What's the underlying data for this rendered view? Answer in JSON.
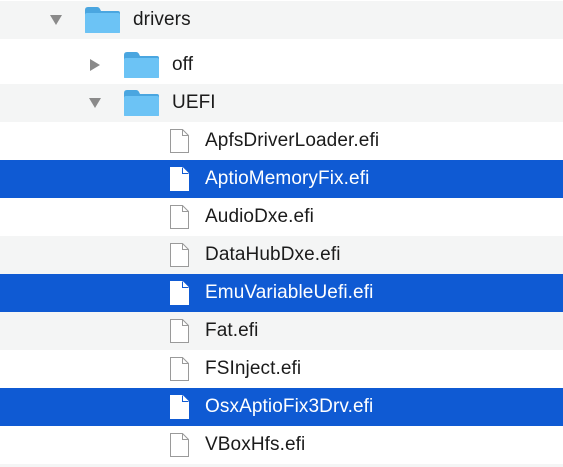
{
  "tree": {
    "folders": {
      "drivers": {
        "label": "drivers",
        "expanded": true
      },
      "off": {
        "label": "off",
        "expanded": false
      },
      "uefi": {
        "label": "UEFI",
        "expanded": true
      }
    },
    "files": [
      {
        "label": "ApfsDriverLoader.efi",
        "selected": false
      },
      {
        "label": "AptioMemoryFix.efi",
        "selected": true
      },
      {
        "label": "AudioDxe.efi",
        "selected": false
      },
      {
        "label": "DataHubDxe.efi",
        "selected": false
      },
      {
        "label": "EmuVariableUefi.efi",
        "selected": true
      },
      {
        "label": "Fat.efi",
        "selected": false
      },
      {
        "label": "FSInject.efi",
        "selected": false
      },
      {
        "label": "OsxAptioFix3Drv.efi",
        "selected": true
      },
      {
        "label": "VBoxHfs.efi",
        "selected": false
      }
    ]
  },
  "colors": {
    "selection": "#0f5ad3",
    "alternate_row": "#f4f5f5",
    "folder_body": "#56b6f0",
    "folder_tab": "#4aa6e0",
    "disclosure": "#8a8a8a"
  }
}
